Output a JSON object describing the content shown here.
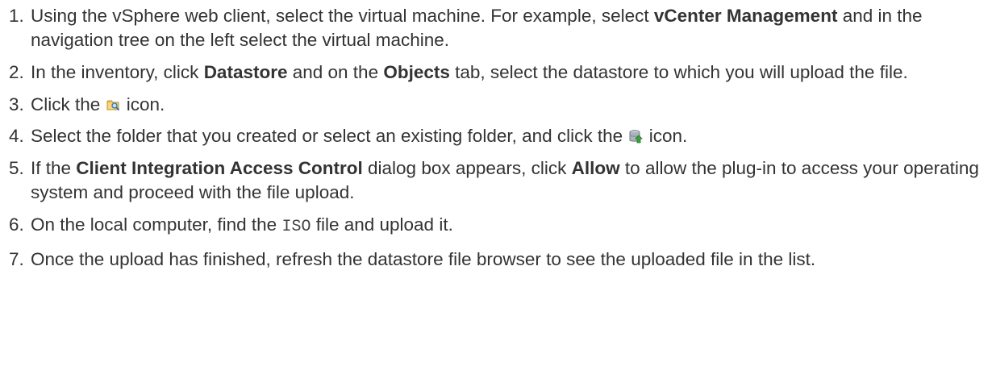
{
  "steps": [
    {
      "num": "1.",
      "parts": {
        "a": "Using the vSphere web client, select the virtual machine. For example, select ",
        "b": "vCenter Management",
        "c": " and in the navigation tree on the left select the virtual machine."
      }
    },
    {
      "num": "2.",
      "parts": {
        "a": "In the inventory, click ",
        "b": "Datastore",
        "c": " and on the ",
        "d": "Objects",
        "e": " tab, select the datastore to which you will upload the file."
      }
    },
    {
      "num": "3.",
      "parts": {
        "a": "Click the ",
        "icon": "browse-datastore-icon",
        "b": " icon."
      }
    },
    {
      "num": "4.",
      "parts": {
        "a": "Select the folder that you created or select an existing folder, and click the ",
        "icon": "upload-file-icon",
        "b": " icon."
      }
    },
    {
      "num": "5.",
      "parts": {
        "a": "If the ",
        "b": "Client Integration Access Control",
        "c": " dialog box appears, click ",
        "d": "Allow",
        "e": " to allow the plug-in to access your operating system and proceed with the file upload."
      }
    },
    {
      "num": "6.",
      "parts": {
        "a": "On the local computer, find the ",
        "code": "ISO",
        "b": " file and upload it."
      }
    },
    {
      "num": "7.",
      "parts": {
        "a": "Once the upload has finished, refresh the datastore file browser to see the uploaded file in the list."
      }
    }
  ]
}
